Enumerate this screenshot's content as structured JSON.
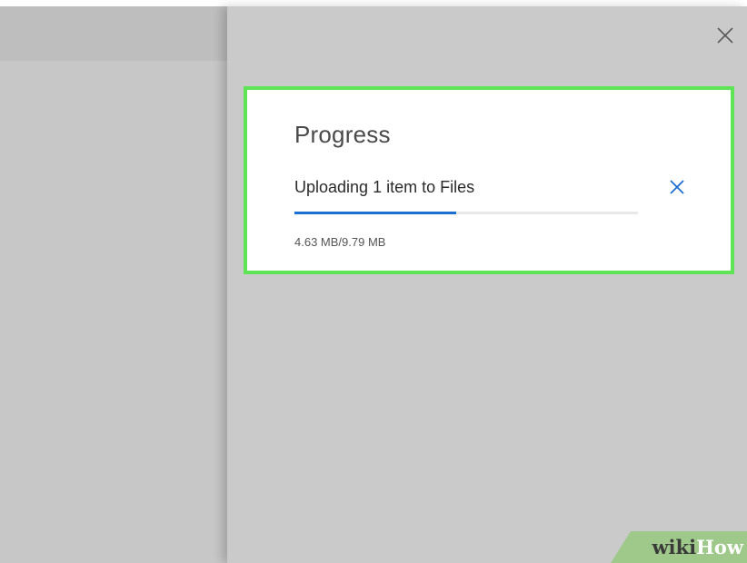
{
  "panel": {
    "close_icon": "close-icon"
  },
  "progress_card": {
    "title": "Progress",
    "item_label": "Uploading 1 item to Files",
    "cancel_icon": "close-icon",
    "uploaded": "4.63 MB",
    "total": "9.79 MB",
    "size_text": "4.63 MB/9.79 MB",
    "progress_fraction": 0.47,
    "highlight_color": "#5ee455",
    "accent_color": "#1a6fd1"
  },
  "watermark": {
    "part1": "wiki",
    "part2": "How"
  }
}
